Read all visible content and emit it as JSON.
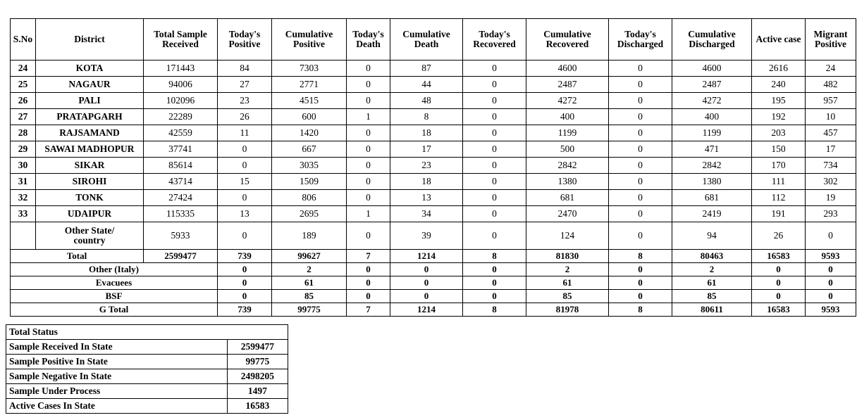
{
  "district_table": {
    "columns": [
      {
        "key": "sno",
        "label_lines": [
          "S.No"
        ]
      },
      {
        "key": "district",
        "label_lines": [
          "District"
        ]
      },
      {
        "key": "total_sample_received",
        "label_lines": [
          "Total Sample",
          "Received"
        ]
      },
      {
        "key": "todays_positive",
        "label_lines": [
          "Today's",
          "Positive"
        ]
      },
      {
        "key": "cumulative_positive",
        "label_lines": [
          "Cumulative",
          "Positive"
        ]
      },
      {
        "key": "todays_death",
        "label_lines": [
          "Today's",
          "Death"
        ]
      },
      {
        "key": "cumulative_death",
        "label_lines": [
          "Cumulative",
          "Death"
        ]
      },
      {
        "key": "todays_recovered",
        "label_lines": [
          "Today's",
          "Recovered"
        ]
      },
      {
        "key": "cumulative_recovered",
        "label_lines": [
          "Cumulative",
          "Recovered"
        ]
      },
      {
        "key": "todays_discharged",
        "label_lines": [
          "Today's",
          "Discharged"
        ]
      },
      {
        "key": "cumulative_discharged",
        "label_lines": [
          "Cumulative",
          "Discharged"
        ]
      },
      {
        "key": "active_case",
        "label_lines": [
          "Active  case"
        ]
      },
      {
        "key": "migrant_positive",
        "label_lines": [
          "Migrant",
          "Positive"
        ]
      }
    ],
    "rows": [
      {
        "sno": "24",
        "district": "KOTA",
        "total_sample_received": "171443",
        "todays_positive": "84",
        "cumulative_positive": "7303",
        "todays_death": "0",
        "cumulative_death": "87",
        "todays_recovered": "0",
        "cumulative_recovered": "4600",
        "todays_discharged": "0",
        "cumulative_discharged": "4600",
        "active_case": "2616",
        "migrant_positive": "24"
      },
      {
        "sno": "25",
        "district": "NAGAUR",
        "total_sample_received": "94006",
        "todays_positive": "27",
        "cumulative_positive": "2771",
        "todays_death": "0",
        "cumulative_death": "44",
        "todays_recovered": "0",
        "cumulative_recovered": "2487",
        "todays_discharged": "0",
        "cumulative_discharged": "2487",
        "active_case": "240",
        "migrant_positive": "482"
      },
      {
        "sno": "26",
        "district": "PALI",
        "total_sample_received": "102096",
        "todays_positive": "23",
        "cumulative_positive": "4515",
        "todays_death": "0",
        "cumulative_death": "48",
        "todays_recovered": "0",
        "cumulative_recovered": "4272",
        "todays_discharged": "0",
        "cumulative_discharged": "4272",
        "active_case": "195",
        "migrant_positive": "957"
      },
      {
        "sno": "27",
        "district": "PRATAPGARH",
        "total_sample_received": "22289",
        "todays_positive": "26",
        "cumulative_positive": "600",
        "todays_death": "1",
        "cumulative_death": "8",
        "todays_recovered": "0",
        "cumulative_recovered": "400",
        "todays_discharged": "0",
        "cumulative_discharged": "400",
        "active_case": "192",
        "migrant_positive": "10"
      },
      {
        "sno": "28",
        "district": "RAJSAMAND",
        "total_sample_received": "42559",
        "todays_positive": "11",
        "cumulative_positive": "1420",
        "todays_death": "0",
        "cumulative_death": "18",
        "todays_recovered": "0",
        "cumulative_recovered": "1199",
        "todays_discharged": "0",
        "cumulative_discharged": "1199",
        "active_case": "203",
        "migrant_positive": "457"
      },
      {
        "sno": "29",
        "district": "SAWAI MADHOPUR",
        "total_sample_received": "37741",
        "todays_positive": "0",
        "cumulative_positive": "667",
        "todays_death": "0",
        "cumulative_death": "17",
        "todays_recovered": "0",
        "cumulative_recovered": "500",
        "todays_discharged": "0",
        "cumulative_discharged": "471",
        "active_case": "150",
        "migrant_positive": "17"
      },
      {
        "sno": "30",
        "district": "SIKAR",
        "total_sample_received": "85614",
        "todays_positive": "0",
        "cumulative_positive": "3035",
        "todays_death": "0",
        "cumulative_death": "23",
        "todays_recovered": "0",
        "cumulative_recovered": "2842",
        "todays_discharged": "0",
        "cumulative_discharged": "2842",
        "active_case": "170",
        "migrant_positive": "734"
      },
      {
        "sno": "31",
        "district": "SIROHI",
        "total_sample_received": "43714",
        "todays_positive": "15",
        "cumulative_positive": "1509",
        "todays_death": "0",
        "cumulative_death": "18",
        "todays_recovered": "0",
        "cumulative_recovered": "1380",
        "todays_discharged": "0",
        "cumulative_discharged": "1380",
        "active_case": "111",
        "migrant_positive": "302"
      },
      {
        "sno": "32",
        "district": "TONK",
        "total_sample_received": "27424",
        "todays_positive": "0",
        "cumulative_positive": "806",
        "todays_death": "0",
        "cumulative_death": "13",
        "todays_recovered": "0",
        "cumulative_recovered": "681",
        "todays_discharged": "0",
        "cumulative_discharged": "681",
        "active_case": "112",
        "migrant_positive": "19"
      },
      {
        "sno": "33",
        "district": "UDAIPUR",
        "total_sample_received": "115335",
        "todays_positive": "13",
        "cumulative_positive": "2695",
        "todays_death": "1",
        "cumulative_death": "34",
        "todays_recovered": "0",
        "cumulative_recovered": "2470",
        "todays_discharged": "0",
        "cumulative_discharged": "2419",
        "active_case": "191",
        "migrant_positive": "293"
      }
    ],
    "other_state_row": {
      "sno": "",
      "district_line1": "Other State/",
      "district_line2": "country",
      "total_sample_received": "5933",
      "todays_positive": "0",
      "cumulative_positive": "189",
      "todays_death": "0",
      "cumulative_death": "39",
      "todays_recovered": "0",
      "cumulative_recovered": "124",
      "todays_discharged": "0",
      "cumulative_discharged": "94",
      "active_case": "26",
      "migrant_positive": "0"
    },
    "total_row": {
      "label": "Total",
      "total_sample_received": "2599477",
      "todays_positive": "739",
      "cumulative_positive": "99627",
      "todays_death": "7",
      "cumulative_death": "1214",
      "todays_recovered": "8",
      "cumulative_recovered": "81830",
      "todays_discharged": "8",
      "cumulative_discharged": "80463",
      "active_case": "16583",
      "migrant_positive": "9593"
    },
    "summary_rows": [
      {
        "label": "Other (Italy)",
        "todays_positive": "0",
        "cumulative_positive": "2",
        "todays_death": "0",
        "cumulative_death": "0",
        "todays_recovered": "0",
        "cumulative_recovered": "2",
        "todays_discharged": "0",
        "cumulative_discharged": "2",
        "active_case": "0",
        "migrant_positive": "0"
      },
      {
        "label": "Evacuees",
        "todays_positive": "0",
        "cumulative_positive": "61",
        "todays_death": "0",
        "cumulative_death": "0",
        "todays_recovered": "0",
        "cumulative_recovered": "61",
        "todays_discharged": "0",
        "cumulative_discharged": "61",
        "active_case": "0",
        "migrant_positive": "0"
      },
      {
        "label": "BSF",
        "todays_positive": "0",
        "cumulative_positive": "85",
        "todays_death": "0",
        "cumulative_death": "0",
        "todays_recovered": "0",
        "cumulative_recovered": "85",
        "todays_discharged": "0",
        "cumulative_discharged": "85",
        "active_case": "0",
        "migrant_positive": "0"
      },
      {
        "label": "G Total",
        "todays_positive": "739",
        "cumulative_positive": "99775",
        "todays_death": "7",
        "cumulative_death": "1214",
        "todays_recovered": "8",
        "cumulative_recovered": "81978",
        "todays_discharged": "8",
        "cumulative_discharged": "80611",
        "active_case": "16583",
        "migrant_positive": "9593"
      }
    ]
  },
  "status_table": {
    "header": "Total Status",
    "rows": [
      {
        "label": "Sample Received In State",
        "value": "2599477"
      },
      {
        "label": "Sample Positive In State",
        "value": "99775"
      },
      {
        "label": "Sample Negative In State",
        "value": "2498205"
      },
      {
        "label": "Sample Under Process",
        "value": "1497"
      },
      {
        "label": "Active Cases In State",
        "value": "16583"
      }
    ]
  }
}
